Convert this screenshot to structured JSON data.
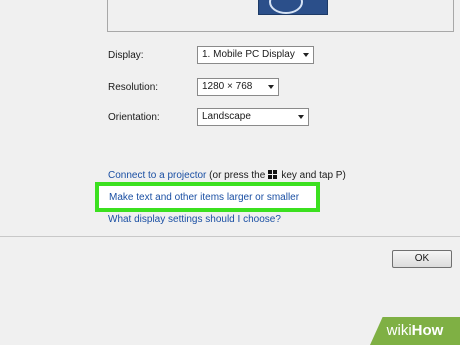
{
  "settings": {
    "display_label": "Display:",
    "display_value": "1. Mobile PC Display",
    "resolution_label": "Resolution:",
    "resolution_value": "1280 × 768",
    "orientation_label": "Orientation:",
    "orientation_value": "Landscape"
  },
  "links": {
    "connect_projector": "Connect to a projector",
    "connect_suffix_1": "(or press the",
    "connect_suffix_2": "key and tap P)",
    "make_text_larger": "Make text and other items larger or smaller",
    "what_settings": "What display settings should I choose?"
  },
  "buttons": {
    "ok": "OK"
  },
  "watermark": {
    "brand_a": "wiki",
    "brand_b": "How"
  },
  "colors": {
    "highlight": "#3be01f",
    "link": "#1a4fa3",
    "monitor": "#2b4f8a",
    "watermark": "#7fb044"
  },
  "icons": {
    "windows_key": "windows-logo-icon"
  }
}
